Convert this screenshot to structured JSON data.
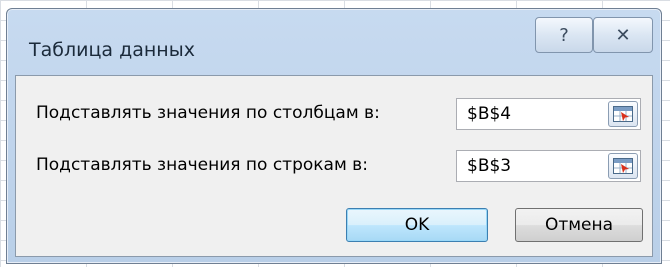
{
  "dialog": {
    "title": "Таблица данных",
    "help_glyph": "?",
    "close_glyph": "✕"
  },
  "fields": [
    {
      "label": "Подставлять значения по столбцам в:",
      "value": "$B$4"
    },
    {
      "label": "Подставлять значения по строкам в:",
      "value": "$B$3"
    }
  ],
  "buttons": {
    "ok_label": "OK",
    "cancel_label": "Отмена"
  },
  "icons": {
    "help": "help-icon",
    "close": "close-icon",
    "range_select": "range-select-icon"
  },
  "colors": {
    "ok_border": "#3c7fb1",
    "title_bar": "#c7daf0"
  }
}
